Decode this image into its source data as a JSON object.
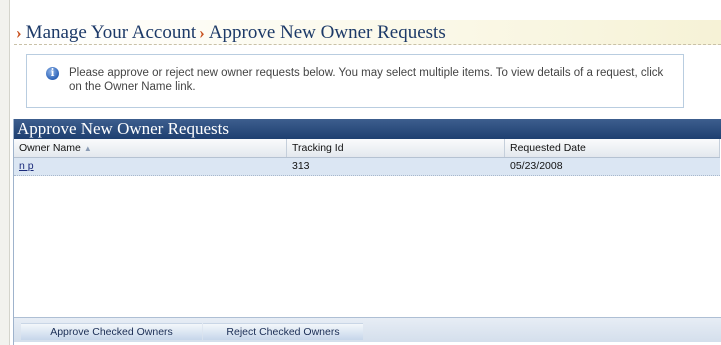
{
  "breadcrumb": {
    "separator": "›",
    "items": [
      "Manage Your Account",
      "Approve New Owner Requests"
    ]
  },
  "info": {
    "icon": "info-icon",
    "message": "Please approve or reject new owner requests below. You may select multiple items. To view details of a request, click on the Owner Name link."
  },
  "panel": {
    "title": "Approve New Owner Requests"
  },
  "grid": {
    "columns": {
      "owner": "Owner Name",
      "tracking": "Tracking Id",
      "date": "Requested Date"
    },
    "sort_indicator": "▲",
    "rows": [
      {
        "owner": "n p",
        "tracking": "313",
        "date": "05/23/2008"
      }
    ]
  },
  "footer": {
    "approve_label": "Approve Checked Owners",
    "reject_label": "Reject Checked Owners"
  },
  "colors": {
    "title_bar": "#1e3f70",
    "breadcrumb_text": "#1d3a68",
    "breadcrumb_separator": "#c8501e",
    "row_highlight": "#dbe6f3"
  }
}
